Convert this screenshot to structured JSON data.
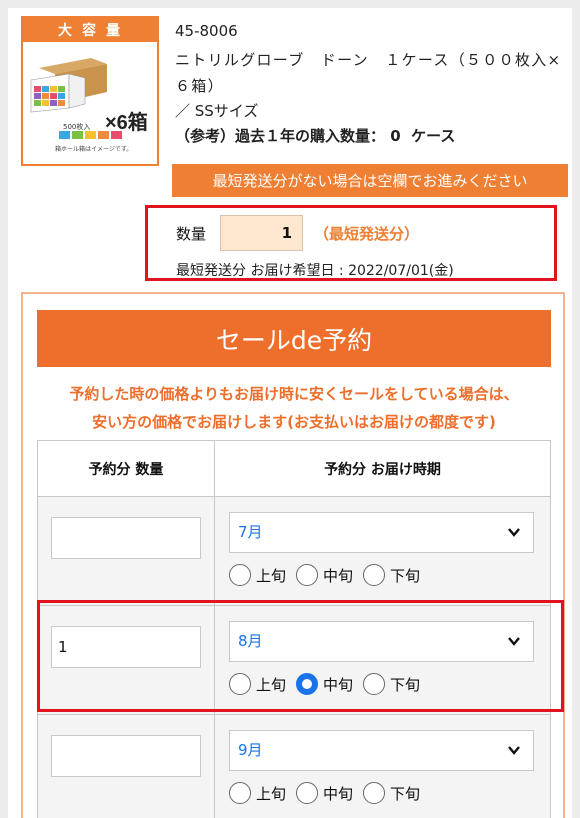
{
  "product": {
    "image": {
      "banner": "大容量",
      "multiplier": "×6箱",
      "count": "500枚入",
      "note": "箱ホール箱はイメージです。",
      "sizes": [
        "S",
        "SS",
        "S",
        "M",
        "L"
      ]
    },
    "code": "45-8006",
    "name": "ニトリルグローブ　ドーン　１ケース（５００枚入×６箱）",
    "size": "／ SSサイズ",
    "history": "（参考）過去１年の購入数量： 0  ケース"
  },
  "notice": "最短発送分がない場合は空欄でお進みください",
  "quantity": {
    "label": "数量",
    "value": "1",
    "tag": "（最短発送分）",
    "delivery": "最短発送分 お届け希望日 : 2022/07/01(金)"
  },
  "reservation": {
    "title": "セールde予約",
    "description_line1": "予約した時の価格よりもお届け時に安くセールをしている場合は、",
    "description_line2": "安い方の価格でお届けします(お支払いはお届けの都度です)",
    "col_qty": "予約分 数量",
    "col_period": "予約分 お届け時期",
    "period_options": [
      "上旬",
      "中旬",
      "下旬"
    ],
    "rows": [
      {
        "qty": "",
        "month": "7月",
        "selected": null
      },
      {
        "qty": "1",
        "month": "8月",
        "selected": "中旬"
      },
      {
        "qty": "",
        "month": "9月",
        "selected": null
      }
    ]
  },
  "colors": {
    "accent": "#ee7f33",
    "header": "#ee6e2c",
    "highlight": "#e0141f",
    "link": "#1a73e8"
  }
}
